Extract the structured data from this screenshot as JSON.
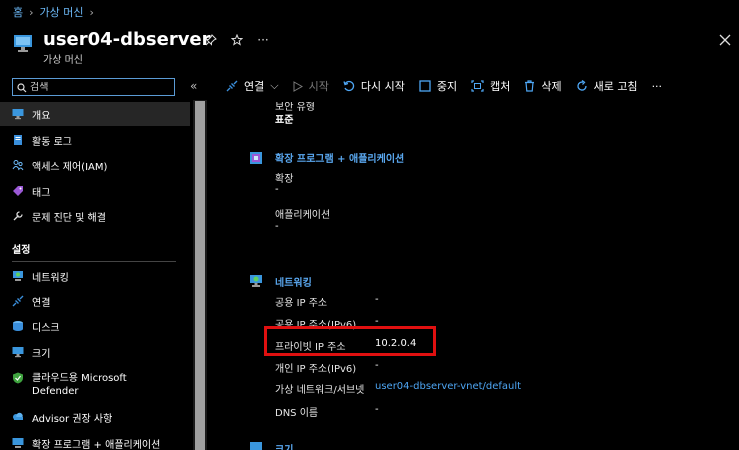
{
  "breadcrumb": {
    "home": "홈",
    "vm": "가상 머신"
  },
  "header": {
    "title": "user04-dbserver",
    "subtitle": "가상 머신",
    "more": "···"
  },
  "search": {
    "placeholder": "검색"
  },
  "sidebar": {
    "items": [
      {
        "label": "개요"
      },
      {
        "label": "활동 로그"
      },
      {
        "label": "액세스 제어(IAM)"
      },
      {
        "label": "태그"
      },
      {
        "label": "문제 진단 및 해결"
      }
    ],
    "section": "설정",
    "settings": [
      {
        "label": "네트워킹"
      },
      {
        "label": "연결"
      },
      {
        "label": "디스크"
      },
      {
        "label": "크기"
      },
      {
        "label": "클라우드용 Microsoft",
        "label2": "Defender"
      },
      {
        "label": "Advisor 권장 사항"
      },
      {
        "label": "확장 프로그램 + 애플리케이션"
      }
    ]
  },
  "toolbar": {
    "connect": "연결",
    "start": "시작",
    "restart": "다시 시작",
    "stop": "중지",
    "capture": "캡처",
    "delete": "삭제",
    "refresh": "새로 고침",
    "more": "···"
  },
  "content": {
    "security_type_label": "보안 유형",
    "security_type_value": "표준",
    "ext_title": "확장 프로그램 + 애플리케이션",
    "ext_label": "확장",
    "ext_value": "-",
    "app_label": "애플리케이션",
    "app_value": "-",
    "net_title": "네트워킹",
    "public_ip_label": "공용 IP 주소",
    "public_ip_value": "-",
    "public_ipv6_label": "공용 IP 주소(IPv6)",
    "public_ipv6_value": "-",
    "private_ip_label": "프라이빗 IP 주소",
    "private_ip_value": "10.2.0.4",
    "private_ipv6_label": "개인 IP 주소(IPv6)",
    "private_ipv6_value": "-",
    "vnet_label": "가상 네트워크/서브넷",
    "vnet_value": "user04-dbserver-vnet/default",
    "dns_label": "DNS 이름",
    "dns_value": "-",
    "size_title": "크기"
  }
}
